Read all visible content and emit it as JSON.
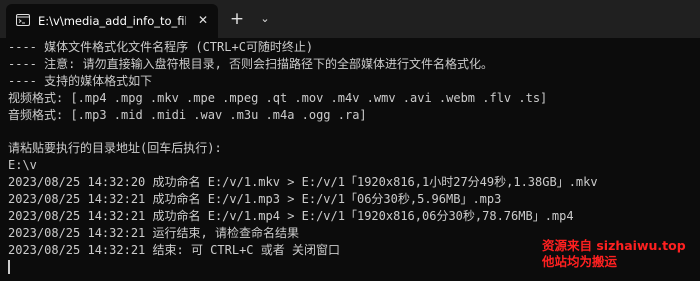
{
  "tab": {
    "title": "E:\\v\\media_add_info_to_filena",
    "icon": "terminal-icon",
    "close_glyph": "✕"
  },
  "tabbar": {
    "new_tab_glyph": "+",
    "dropdown_glyph": "⌄"
  },
  "console": {
    "lines": [
      "---- 媒体文件格式化文件名程序 (CTRL+C可随时终止)",
      "---- 注意: 请勿直接输入盘符根目录, 否则会扫描路径下的全部媒体进行文件名格式化。",
      "---- 支持的媒体格式如下",
      "视频格式: [.mp4 .mpg .mkv .mpe .mpeg .qt .mov .m4v .wmv .avi .webm .flv .ts]",
      "音频格式: [.mp3 .mid .midi .wav .m3u .m4a .ogg .ra]",
      "",
      "请粘贴要执行的目录地址(回车后执行):",
      "E:\\v",
      "2023/08/25 14:32:20 成功命名 E:/v/1.mkv > E:/v/1「1920x816,1小时27分49秒,1.38GB」.mkv",
      "2023/08/25 14:32:21 成功命名 E:/v/1.mp3 > E:/v/1「06分30秒,5.96MB」.mp3",
      "2023/08/25 14:32:21 成功命名 E:/v/1.mp4 > E:/v/1「1920x816,06分30秒,78.76MB」.mp4",
      "2023/08/25 14:32:21 运行结束, 请检查命名结果",
      "2023/08/25 14:32:21 结束: 可 CTRL+C 或者 关闭窗口"
    ]
  },
  "watermark": {
    "line1": "资源来自 sizhaiwu.top",
    "line2": "他站均为搬运"
  },
  "colors": {
    "background": "#0c0c0c",
    "tabbar": "#202020",
    "text": "#cccccc",
    "watermark": "#ff2020"
  }
}
